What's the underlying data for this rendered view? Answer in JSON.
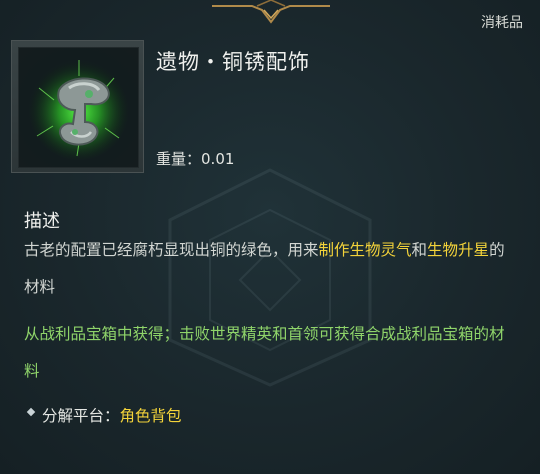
{
  "item": {
    "category": "消耗品",
    "name": "遗物・铜锈配饰",
    "weight_label": "重量：",
    "weight_value": "0.01",
    "icon": "relic-copper-ornament-icon"
  },
  "description": {
    "heading": "描述",
    "text_part1": "古老的配置已经腐朽显现出铜的绿色，用来",
    "highlight1": "制作生物灵气",
    "connector": "和",
    "highlight2": "生物升星",
    "text_part2": "的材料"
  },
  "source": {
    "text": "从战利品宝箱中获得；击败世界精英和首领可获得合成战利品宝箱的材料"
  },
  "dismantle": {
    "label": "分解平台：",
    "value": "角色背包"
  },
  "colors": {
    "background": "#1a272c",
    "highlight": "#f3d33a",
    "source_green": "#8fd46a",
    "icon_glow": "#3fd13a"
  }
}
